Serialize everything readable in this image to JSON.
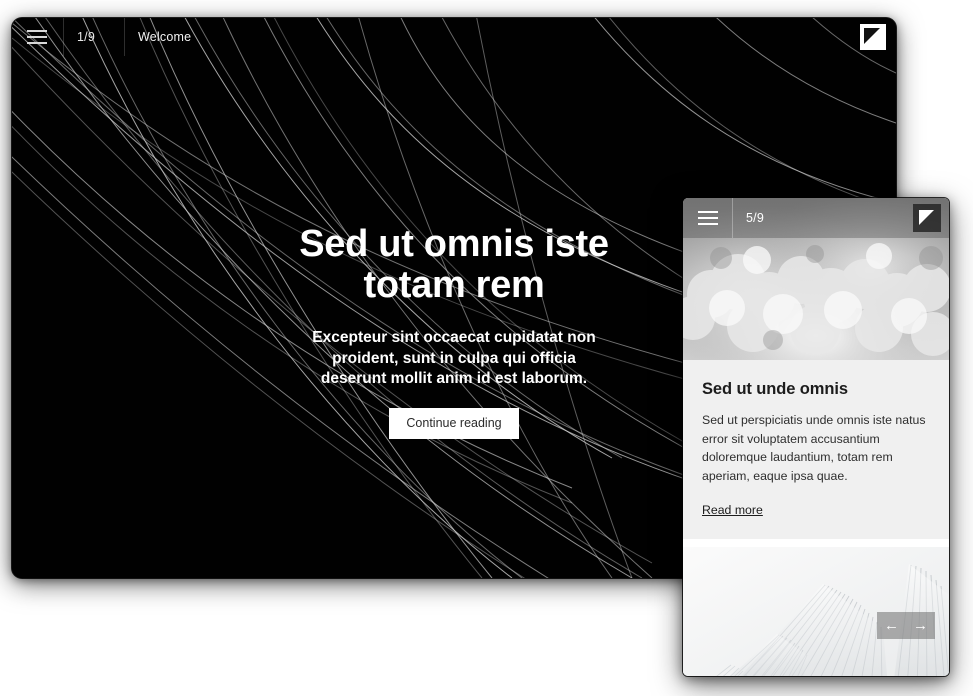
{
  "desktop": {
    "header": {
      "menu_icon": "hamburger-icon",
      "page_indicator": "1/9",
      "title": "Welcome",
      "logo_icon": "triangle-logo-icon"
    },
    "hero": {
      "heading": "Sed ut omnis iste totam rem",
      "subheading": "Excepteur sint occaecat cupidatat non proident, sunt in culpa qui officia deserunt mollit anim id est laborum.",
      "cta_label": "Continue reading"
    },
    "background": {
      "style": "black background with thin white curved lines",
      "color": "#010101",
      "line_color": "#c9c9c9"
    }
  },
  "mobile": {
    "header": {
      "menu_icon": "hamburger-icon",
      "page_indicator": "5/9",
      "logo_icon": "triangle-logo-icon"
    },
    "hero_image": {
      "alt": "grayscale cumulus clouds",
      "icon": "clouds-image"
    },
    "card": {
      "heading": "Sed ut unde omnis",
      "body": "Sed ut perspiciatis unde omnis iste natus error sit voluptatem accusantium doloremque laudantium, totam rem aperiam, eaque ipsa quae.",
      "link_label": "Read more"
    },
    "gallery": {
      "alt": "white architectural fan-shaped roof structure",
      "icon": "architecture-image",
      "prev_label": "←",
      "next_label": "→"
    }
  },
  "colors": {
    "desktop_bg": "#010101",
    "panel_bg": "#f0f0f0",
    "accent_white": "#ffffff",
    "text_dark": "#1c1c1c"
  }
}
